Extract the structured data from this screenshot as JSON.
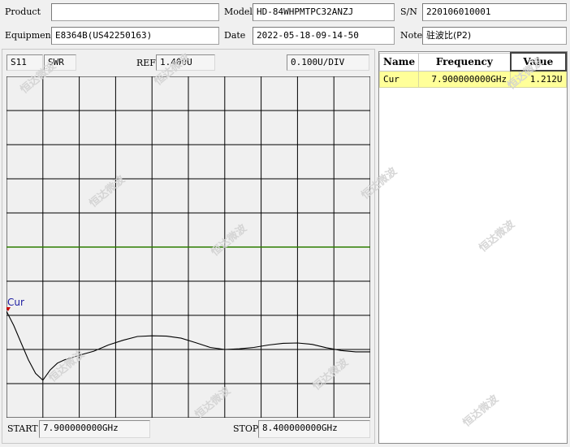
{
  "header": {
    "product_label": "Product",
    "product_value": "",
    "model_label": "Model",
    "model_value": "HD-84WHPMTPC32ANZJ",
    "sn_label": "S/N",
    "sn_value": "220106010001",
    "equipment_label": "Equipment",
    "equipment_value": "E8364B(US42250163)",
    "date_label": "Date",
    "date_value": "2022-05-18-09-14-50",
    "note_label": "Note",
    "note_value": "驻波比(P2)"
  },
  "trace_info": {
    "param": "S11",
    "format": "SWR",
    "ref_label": "REF",
    "ref_value": "1.400U",
    "scale_value": "0.100U/DIV"
  },
  "footer": {
    "start_label": "START",
    "start_value": "7.900000000GHz",
    "stop_label": "STOP",
    "stop_value": "8.400000000GHz"
  },
  "marker_table": {
    "headers": [
      "Name",
      "Frequency",
      "Value"
    ],
    "rows": [
      {
        "name": "Cur",
        "frequency": "7.900000000GHz",
        "value": "1.212U"
      }
    ]
  },
  "watermark": "恒达微波",
  "colors": {
    "trace": "#000000",
    "reference_line": "#2e7d00",
    "grid": "#000000",
    "marker": "#cc0000",
    "marker_label": "#1a1aa0",
    "marker_row_bg": "#ffff99"
  },
  "chart_data": {
    "type": "line",
    "x_unit": "GHz",
    "y_unit": "U",
    "xlim": [
      7.9,
      8.4
    ],
    "ylim": [
      0.9,
      1.9
    ],
    "reference_value": 1.4,
    "grid": true,
    "x_divisions": 10,
    "y_divisions": 10,
    "marker": {
      "label": "Cur",
      "x": 7.9,
      "y": 1.212
    },
    "series": [
      {
        "x": [
          7.9,
          7.91,
          7.92,
          7.93,
          7.94,
          7.95,
          7.96,
          7.97,
          7.98,
          7.99,
          8.0,
          8.02,
          8.04,
          8.06,
          8.08,
          8.1,
          8.12,
          8.14,
          8.16,
          8.18,
          8.2,
          8.22,
          8.24,
          8.26,
          8.28,
          8.3,
          8.32,
          8.34,
          8.36,
          8.38,
          8.4
        ],
        "y": [
          1.212,
          1.17,
          1.12,
          1.07,
          1.03,
          1.01,
          1.04,
          1.06,
          1.07,
          1.076,
          1.083,
          1.095,
          1.113,
          1.127,
          1.138,
          1.14,
          1.139,
          1.133,
          1.12,
          1.106,
          1.1,
          1.102,
          1.106,
          1.113,
          1.118,
          1.119,
          1.115,
          1.105,
          1.097,
          1.093,
          1.093
        ]
      }
    ]
  }
}
